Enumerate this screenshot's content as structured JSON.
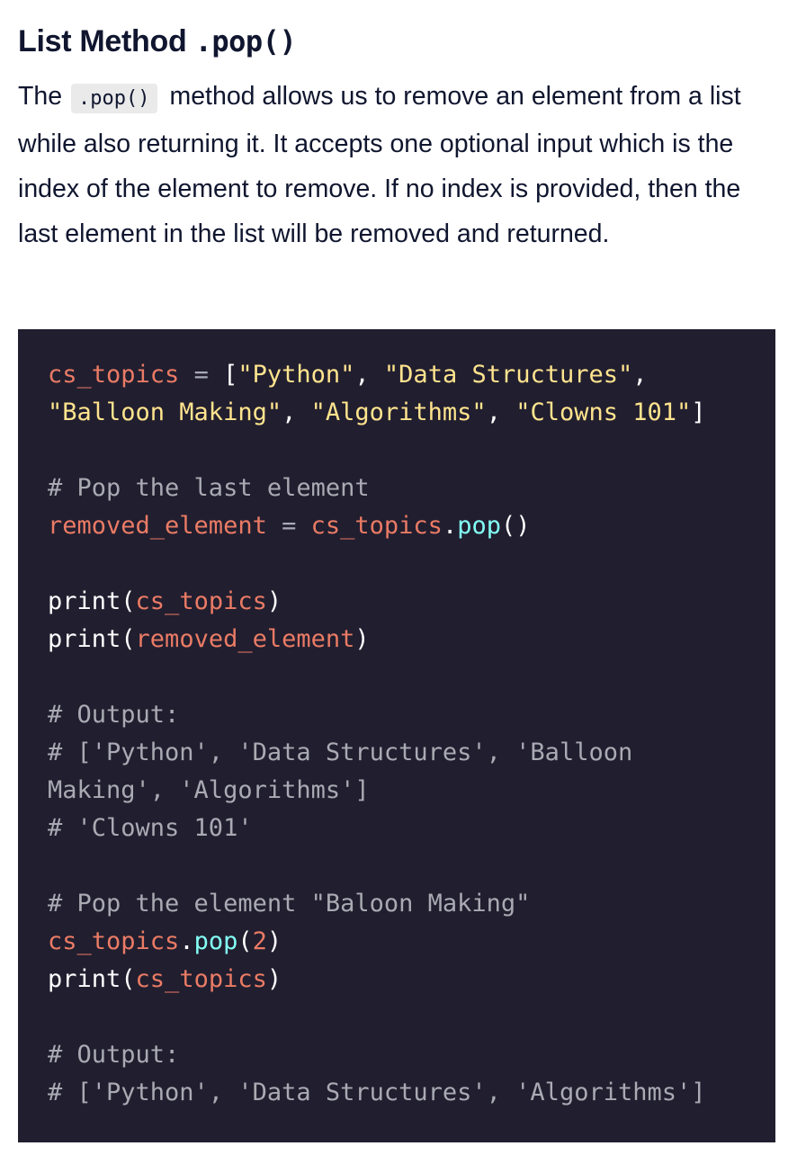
{
  "heading": {
    "prefix": "List Method ",
    "code": ".pop()"
  },
  "description": {
    "before": "The",
    "code": ".pop()",
    "after": "method allows us to remove an element from a list while also returning it. It accepts one optional input which is the index of the element to remove. If no index is provided, then the last element in the list will be removed and returned."
  },
  "code": {
    "l1": {
      "var": "cs_topics",
      "op": " = ",
      "open": "[",
      "s1": "\"Python\"",
      "c1": ", ",
      "s2": "\"Data Structures\"",
      "c2": ","
    },
    "l2": {
      "s3": "\"Balloon Making\"",
      "c3": ", ",
      "s4": "\"Algorithms\"",
      "c4": ", ",
      "s5": "\"Clowns 101\"",
      "close": "]"
    },
    "l4": {
      "comment": "# Pop the last element"
    },
    "l5": {
      "var": "removed_element",
      "op": " = ",
      "obj": "cs_topics",
      "dot": ".",
      "method": "pop",
      "parens": "()"
    },
    "l7": {
      "fn": "print",
      "open": "(",
      "arg": "cs_topics",
      "close": ")"
    },
    "l8": {
      "fn": "print",
      "open": "(",
      "arg": "removed_element",
      "close": ")"
    },
    "l10": {
      "comment": "# Output:"
    },
    "l11": {
      "comment": "# ['Python', 'Data Structures', 'Balloon"
    },
    "l12": {
      "comment": "Making', 'Algorithms']"
    },
    "l13": {
      "comment": "# 'Clowns 101'"
    },
    "l15": {
      "comment": "# Pop the element \"Baloon Making\""
    },
    "l16": {
      "obj": "cs_topics",
      "dot": ".",
      "method": "pop",
      "open": "(",
      "num": "2",
      "close": ")"
    },
    "l17": {
      "fn": "print",
      "open": "(",
      "arg": "cs_topics",
      "close": ")"
    },
    "l19": {
      "comment": "# Output:"
    },
    "l20": {
      "comment": "# ['Python', 'Data Structures', 'Algorithms']"
    }
  }
}
